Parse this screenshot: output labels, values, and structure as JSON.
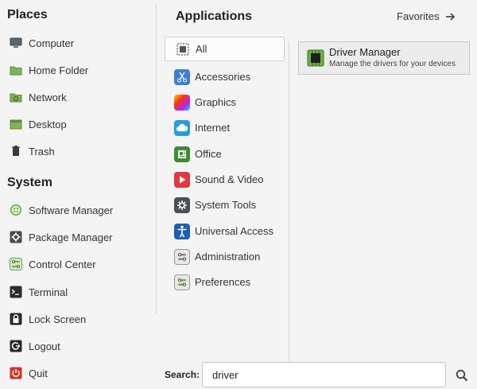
{
  "places": {
    "title": "Places",
    "items": [
      {
        "label": "Computer",
        "icon": "computer-icon"
      },
      {
        "label": "Home Folder",
        "icon": "folder-icon"
      },
      {
        "label": "Network",
        "icon": "network-folder-icon"
      },
      {
        "label": "Desktop",
        "icon": "desktop-folder-icon"
      },
      {
        "label": "Trash",
        "icon": "trash-icon"
      }
    ]
  },
  "system": {
    "title": "System",
    "items": [
      {
        "label": "Software Manager",
        "icon": "software-manager-icon"
      },
      {
        "label": "Package Manager",
        "icon": "package-manager-icon"
      },
      {
        "label": "Control Center",
        "icon": "control-center-icon"
      },
      {
        "label": "Terminal",
        "icon": "terminal-icon"
      },
      {
        "label": "Lock Screen",
        "icon": "lock-icon"
      },
      {
        "label": "Logout",
        "icon": "logout-icon"
      },
      {
        "label": "Quit",
        "icon": "power-icon"
      }
    ]
  },
  "applications": {
    "title": "Applications",
    "favorites_label": "Favorites",
    "categories": [
      {
        "label": "All",
        "icon": "all-grid-icon",
        "selected": true
      },
      {
        "label": "Accessories",
        "icon": "accessories-icon"
      },
      {
        "label": "Graphics",
        "icon": "graphics-icon"
      },
      {
        "label": "Internet",
        "icon": "internet-cloud-icon"
      },
      {
        "label": "Office",
        "icon": "office-icon"
      },
      {
        "label": "Sound & Video",
        "icon": "sound-video-icon"
      },
      {
        "label": "System Tools",
        "icon": "system-tools-icon"
      },
      {
        "label": "Universal Access",
        "icon": "universal-access-icon"
      },
      {
        "label": "Administration",
        "icon": "administration-icon"
      },
      {
        "label": "Preferences",
        "icon": "preferences-icon"
      }
    ]
  },
  "results": [
    {
      "name": "Driver Manager",
      "description": "Manage the drivers for your devices",
      "icon": "driver-chip-icon"
    }
  ],
  "search": {
    "label": "Search:",
    "value": "driver"
  },
  "colors": {
    "background": "#f4f4f4",
    "accent_green": "#6db33f",
    "selected_border": "#cfcfcf"
  }
}
